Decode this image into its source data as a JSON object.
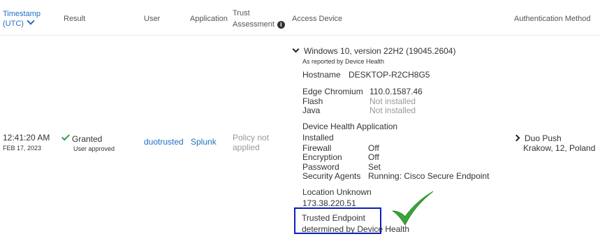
{
  "header": {
    "timestamp_line1": "Timestamp",
    "timestamp_line2": "(UTC)",
    "result": "Result",
    "user": "User",
    "application": "Application",
    "trust_line1": "Trust",
    "trust_line2": "Assessment",
    "access_device": "Access Device",
    "auth_method": "Authentication Method"
  },
  "row": {
    "time": "12:41:20 AM",
    "date": "FEB 17, 2023",
    "result": "Granted",
    "result_sub": "User approved",
    "user": "duotrusted",
    "application": "Splunk",
    "trust_line1": "Policy not",
    "trust_line2": "applied",
    "os": "Windows 10, version 22H2 (19045.2604)",
    "os_sub": "As reported by Device Health",
    "hostname_label": "Hostname",
    "hostname_value": "DESKTOP-R2CH8G5",
    "browser_label": "Edge Chromium",
    "browser_value": "110.0.1587.46",
    "flash_label": "Flash",
    "flash_value": "Not installed",
    "java_label": "Java",
    "java_value": "Not installed",
    "dha_label": "Device Health Application",
    "dha_status": "Installed",
    "firewall_label": "Firewall",
    "firewall_value": "Off",
    "encryption_label": "Encryption",
    "encryption_value": "Off",
    "password_label": "Password",
    "password_value": "Set",
    "agents_label": "Security Agents",
    "agents_value": "Running: Cisco Secure Endpoint",
    "location": "Location Unknown",
    "ip": "173.38.220.51",
    "trusted": "Trusted Endpoint",
    "trusted_sub": "determined by Device Health",
    "auth_method": "Duo Push",
    "auth_location": "Krakow, 12, Poland"
  },
  "colors": {
    "link": "#1f6fc2",
    "granted_check": "#2e9e4f",
    "big_check": "#3aa33a",
    "highlight_box": "#0a1fb8"
  }
}
